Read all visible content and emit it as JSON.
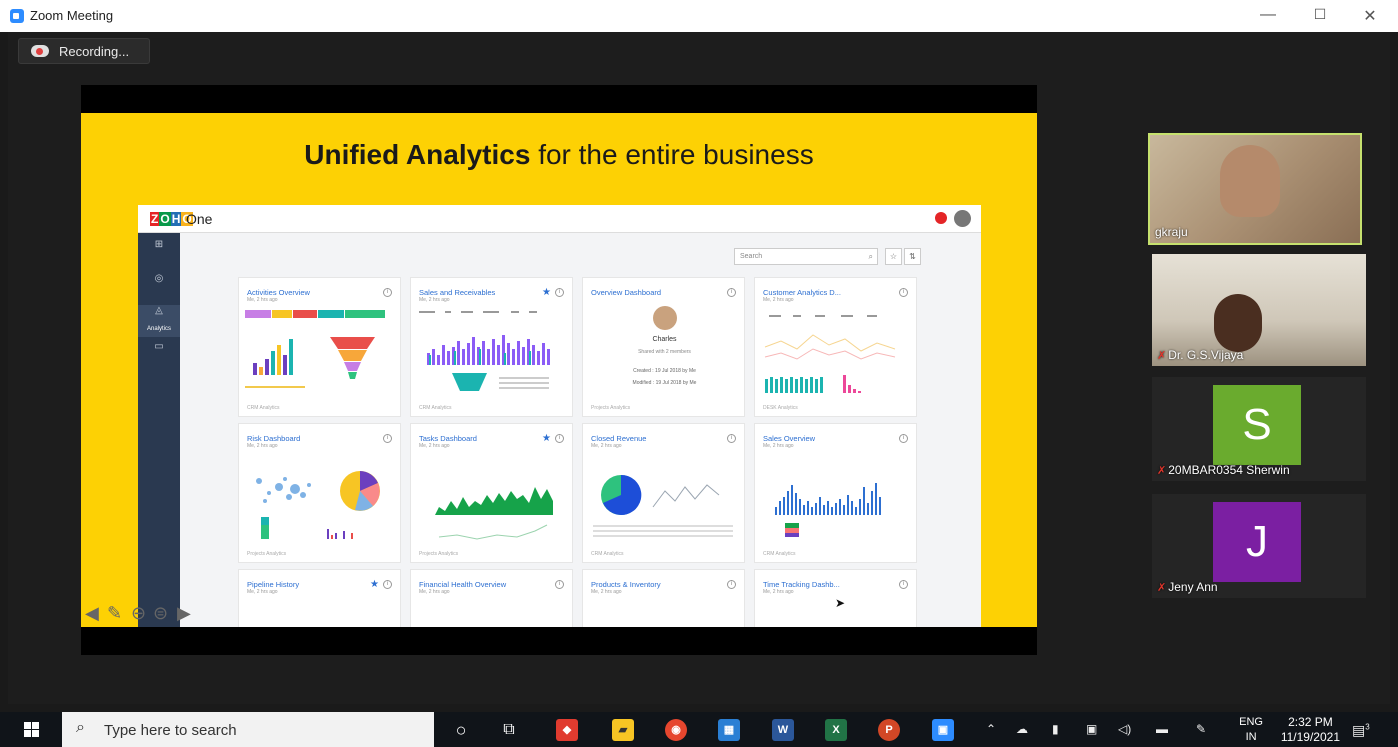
{
  "window": {
    "title": "Zoom Meeting",
    "minimize": "—",
    "maximize": "☐",
    "close": "✕"
  },
  "recording": {
    "label": "Recording..."
  },
  "slide": {
    "title_bold": "Unified Analytics",
    "title_rest": " for the entire business",
    "app_name": "One",
    "zoho_letters": [
      "Z",
      "O",
      "H",
      "O"
    ],
    "sidebar_label": "Analytics",
    "search_placeholder": "Search",
    "cards": [
      {
        "title": "Activities Overview",
        "sub": "Me, 2 hrs ago",
        "footer": "CRM Analytics",
        "star": false
      },
      {
        "title": "Sales and Receivables",
        "sub": "Me, 2 hrs ago",
        "footer": "CRM Analytics",
        "star": true
      },
      {
        "title": "Overview Dashboard",
        "sub": "",
        "footer": "Projects Analytics",
        "star": false
      },
      {
        "title": "Customer Analytics D...",
        "sub": "Me, 2 hrs ago",
        "footer": "DESK Analytics",
        "star": false
      },
      {
        "title": "Risk Dashboard",
        "sub": "Me, 2 hrs ago",
        "footer": "Projects Analytics",
        "star": false
      },
      {
        "title": "Tasks Dashboard",
        "sub": "Me, 2 hrs ago",
        "footer": "Projects Analytics",
        "star": true
      },
      {
        "title": "Closed Revenue",
        "sub": "Me, 2 hrs ago",
        "footer": "CRM Analytics",
        "star": false
      },
      {
        "title": "Sales Overview",
        "sub": "Me, 2 hrs ago",
        "footer": "CRM Analytics",
        "star": false
      },
      {
        "title": "Pipeline History",
        "sub": "Me, 2 hrs ago",
        "footer": "",
        "star": true
      },
      {
        "title": "Financial Health Overview",
        "sub": "Me, 2 hrs ago",
        "footer": "",
        "star": false
      },
      {
        "title": "Products & Inventory",
        "sub": "Me, 2 hrs ago",
        "footer": "",
        "star": false
      },
      {
        "title": "Time Tracking Dashb...",
        "sub": "Me, 2 hrs ago",
        "footer": "",
        "star": false
      }
    ],
    "overview": {
      "name": "Charles",
      "shared": "Shared with 2 members",
      "created": "Created : 19 Jul 2018 by Me",
      "modified": "Modified : 19 Jul 2018 by Me"
    }
  },
  "participants": [
    {
      "name": "gkraju",
      "type": "video",
      "muted": false
    },
    {
      "name": "Dr. G.S.Vijaya",
      "type": "video",
      "muted": true
    },
    {
      "name": "20MBAR0354 Sherwin",
      "type": "avatar",
      "initial": "S",
      "color": "#6aab2e",
      "muted": true
    },
    {
      "name": "Jeny Ann",
      "type": "avatar",
      "initial": "J",
      "color": "#7b1fa2",
      "muted": true
    }
  ],
  "taskbar": {
    "search_placeholder": "Type here to search",
    "lang_top": "ENG",
    "lang_bottom": "IN",
    "time": "2:32 PM",
    "date": "11/19/2021",
    "notifications": "3"
  },
  "colors": {
    "slide_bg": "#fdd104",
    "active_speaker": "#c6e16e",
    "zoom_blue": "#2d8cff"
  }
}
